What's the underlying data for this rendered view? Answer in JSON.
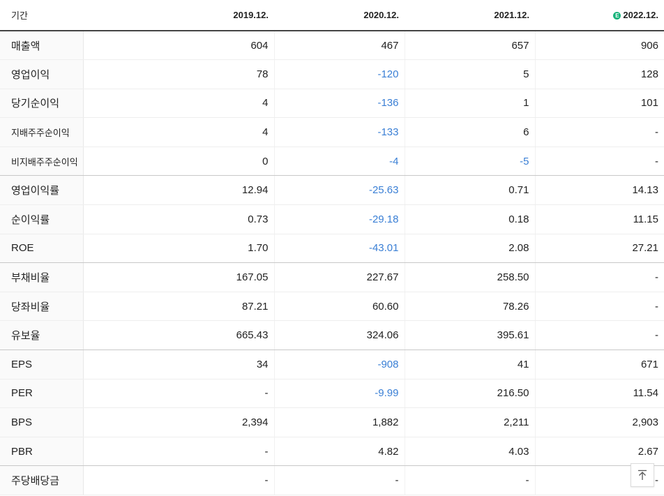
{
  "header": {
    "period_label": "기간",
    "columns": [
      "2019.12.",
      "2020.12.",
      "2021.12.",
      "2022.12."
    ],
    "estimate_icon": "E"
  },
  "rows": [
    {
      "label": "매출액",
      "values": [
        "604",
        "467",
        "657",
        "906"
      ]
    },
    {
      "label": "영업이익",
      "values": [
        "78",
        "-120",
        "5",
        "128"
      ]
    },
    {
      "label": "당기순이익",
      "values": [
        "4",
        "-136",
        "1",
        "101"
      ]
    },
    {
      "label": "지배주주순이익",
      "values": [
        "4",
        "-133",
        "6",
        "-"
      ]
    },
    {
      "label": "비지배주주순이익",
      "values": [
        "0",
        "-4",
        "-5",
        "-"
      ]
    },
    {
      "label": "영업이익률",
      "values": [
        "12.94",
        "-25.63",
        "0.71",
        "14.13"
      ]
    },
    {
      "label": "순이익률",
      "values": [
        "0.73",
        "-29.18",
        "0.18",
        "11.15"
      ]
    },
    {
      "label": "ROE",
      "values": [
        "1.70",
        "-43.01",
        "2.08",
        "27.21"
      ]
    },
    {
      "label": "부채비율",
      "values": [
        "167.05",
        "227.67",
        "258.50",
        "-"
      ]
    },
    {
      "label": "당좌비율",
      "values": [
        "87.21",
        "60.60",
        "78.26",
        "-"
      ]
    },
    {
      "label": "유보율",
      "values": [
        "665.43",
        "324.06",
        "395.61",
        "-"
      ]
    },
    {
      "label": "EPS",
      "values": [
        "34",
        "-908",
        "41",
        "671"
      ]
    },
    {
      "label": "PER",
      "values": [
        "-",
        "-9.99",
        "216.50",
        "11.54"
      ]
    },
    {
      "label": "BPS",
      "values": [
        "2,394",
        "1,882",
        "2,211",
        "2,903"
      ]
    },
    {
      "label": "PBR",
      "values": [
        "-",
        "4.82",
        "4.03",
        "2.67"
      ]
    },
    {
      "label": "주당배당금",
      "values": [
        "-",
        "-",
        "-",
        "-"
      ]
    }
  ],
  "colors": {
    "negative": "#3a7fd5",
    "estimate_badge": "#19b37b"
  }
}
